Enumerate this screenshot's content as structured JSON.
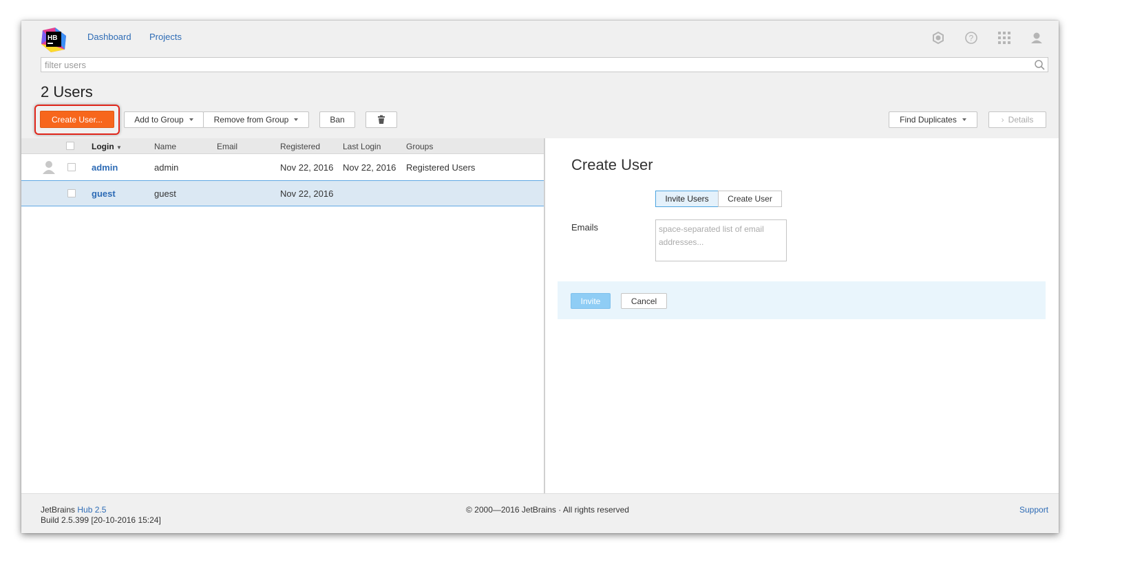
{
  "header": {
    "logo_text": "HB",
    "nav": [
      {
        "label": "Dashboard"
      },
      {
        "label": "Projects"
      }
    ],
    "icons": [
      "settings-icon",
      "help-icon",
      "apps-grid-icon",
      "user-profile-icon"
    ]
  },
  "search": {
    "placeholder": "filter users",
    "value": ""
  },
  "page": {
    "title": "2 Users"
  },
  "toolbar": {
    "create_user": "Create User...",
    "add_to_group": "Add to Group",
    "remove_from_group": "Remove from Group",
    "ban": "Ban",
    "delete_icon": "trash-icon",
    "find_duplicates": "Find Duplicates",
    "details": "Details"
  },
  "table": {
    "columns": [
      "Login",
      "Name",
      "Email",
      "Registered",
      "Last Login",
      "Groups"
    ],
    "rows": [
      {
        "login": "admin",
        "name": "admin",
        "email": "",
        "registered": "Nov 22, 2016",
        "last_login": "Nov 22, 2016",
        "groups": "Registered Users",
        "selected": false
      },
      {
        "login": "guest",
        "name": "guest",
        "email": "",
        "registered": "Nov 22, 2016",
        "last_login": "",
        "groups": "",
        "selected": true
      }
    ]
  },
  "panel": {
    "title": "Create User",
    "tabs": [
      {
        "label": "Invite Users",
        "active": true
      },
      {
        "label": "Create User",
        "active": false
      }
    ],
    "emails_label": "Emails",
    "emails_placeholder": "space-separated list of email addresses...",
    "invite": "Invite",
    "cancel": "Cancel"
  },
  "footer": {
    "brand": "JetBrains",
    "product": "Hub 2.5",
    "build": "Build 2.5.399 [20-10-2016 15:24]",
    "copyright": "© 2000—2016 JetBrains · All rights reserved",
    "support": "Support"
  },
  "colors": {
    "accent_orange": "#f7661c",
    "link_blue": "#2d6bb5",
    "selection_blue": "#dbe8f3",
    "highlight_red": "#e0251a"
  }
}
